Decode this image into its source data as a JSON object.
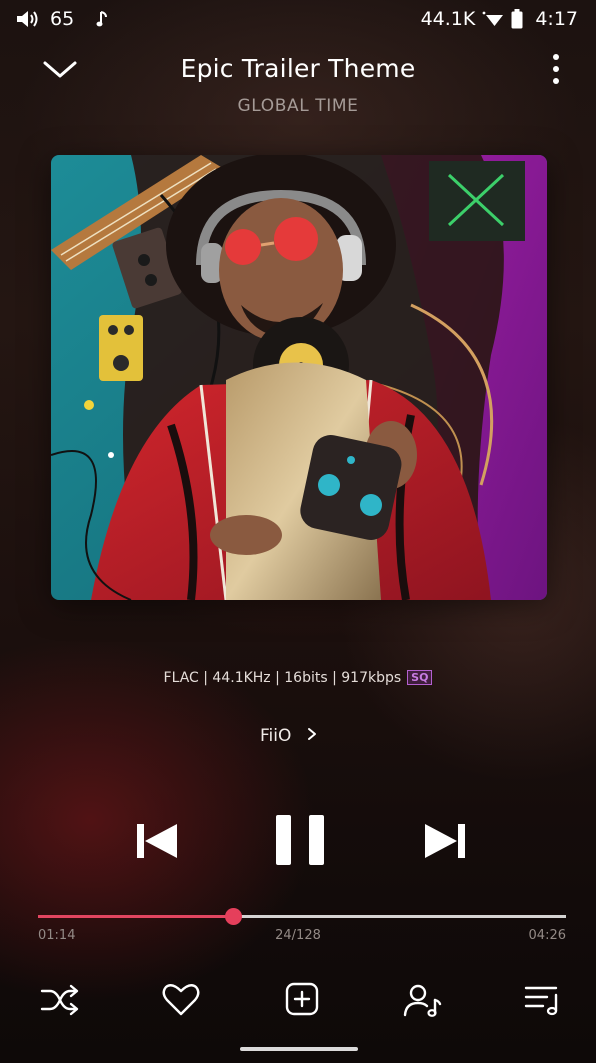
{
  "status_bar": {
    "volume_icon": "volume-icon",
    "volume_level": "65",
    "music_icon": "music-note-icon",
    "sample_rate": "44.1K",
    "wifi_icon": "wifi-icon",
    "battery_icon": "battery-icon",
    "time": "4:17"
  },
  "header": {
    "collapse_icon": "chevron-down-icon",
    "title": "Epic Trailer Theme",
    "artist": "GLOBAL TIME",
    "more_icon": "more-vertical-icon"
  },
  "format": {
    "text": "FLAC | 44.1KHz | 16bits | 917kbps",
    "badge": "SQ",
    "badge_color": "#b460d0"
  },
  "source": {
    "label": "FiiO",
    "chevron": "›"
  },
  "transport": {
    "prev_icon": "skip-previous-icon",
    "pause_icon": "pause-icon",
    "next_icon": "skip-next-icon"
  },
  "progress": {
    "elapsed": "01:14",
    "total": "04:26",
    "track_position": "24/128",
    "fraction": 0.37,
    "accent": "#e24560"
  },
  "actions": {
    "shuffle_icon": "shuffle-icon",
    "favorite_icon": "heart-icon",
    "add_icon": "add-to-playlist-icon",
    "artist_icon": "artist-icon",
    "queue_icon": "queue-icon"
  }
}
